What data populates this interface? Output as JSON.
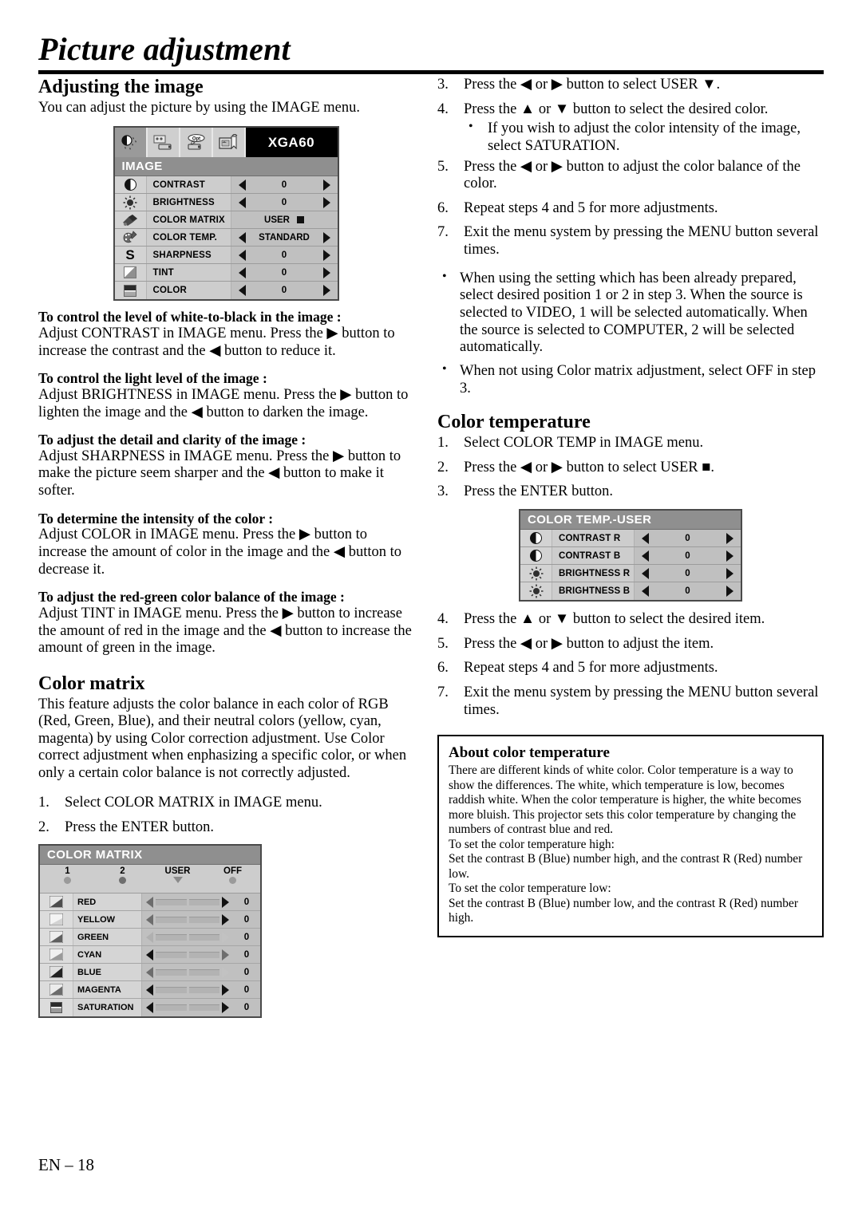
{
  "page": {
    "title": "Picture adjustment",
    "footer": "EN – 18"
  },
  "left": {
    "section1_title": "Adjusting the image",
    "section1_intro": "You can adjust the picture by using the IMAGE menu.",
    "image_menu": {
      "signal_label": "XGA60",
      "menu_title": "IMAGE",
      "tabs": [
        "image-tab-icon",
        "install-tab-icon",
        "option-tab-icon",
        "feature-tab-icon"
      ],
      "rows": [
        {
          "icon": "contrast-icon",
          "label": "CONTRAST",
          "value": "0",
          "control": "arrows"
        },
        {
          "icon": "brightness-icon",
          "label": "BRIGHTNESS",
          "value": "0",
          "control": "arrows"
        },
        {
          "icon": "color-matrix-icon",
          "label": "COLOR MATRIX",
          "value": "USER",
          "control": "square"
        },
        {
          "icon": "color-temp-icon",
          "label": "COLOR TEMP.",
          "value": "STANDARD",
          "control": "arrows"
        },
        {
          "icon": "sharpness-icon",
          "label": "SHARPNESS",
          "value": "0",
          "control": "arrows"
        },
        {
          "icon": "tint-icon",
          "label": "TINT",
          "value": "0",
          "control": "arrows"
        },
        {
          "icon": "color-icon",
          "label": "COLOR",
          "value": "0",
          "control": "arrows"
        }
      ]
    },
    "tips": [
      {
        "head": "To control the level of white-to-black in the image :",
        "body": "Adjust CONTRAST in IMAGE menu.  Press the ▶ button to increase the contrast and the ◀ button to reduce it."
      },
      {
        "head": "To control the light level of the image :",
        "body": "Adjust BRIGHTNESS in IMAGE menu.  Press the ▶ button to lighten the image and the ◀ button to darken the image."
      },
      {
        "head": "To adjust the detail and clarity of the image :",
        "body": "Adjust SHARPNESS in IMAGE menu.  Press the ▶ button to make the picture seem sharper and the ◀ button to make it softer."
      },
      {
        "head": "To determine the intensity of the color :",
        "body": "Adjust COLOR in IMAGE menu.  Press the ▶ button to increase the amount of color in the image and the ◀ button to decrease it."
      },
      {
        "head": "To adjust the red-green color balance of the image :",
        "body": "Adjust TINT in IMAGE menu.  Press the ▶ button to increase the amount of red in the image and the ◀ button to increase the amount of green in the image."
      }
    ],
    "section2_title": "Color matrix",
    "section2_body": "This feature adjusts the color balance in each color of RGB (Red, Green, Blue), and their neutral colors (yellow, cyan, magenta) by using Color correction adjustment. Use Color correct adjustment when enphasizing a specific color, or when only a certain color balance is not correctly adjusted.",
    "section2_steps": [
      {
        "num": "1.",
        "text": "Select COLOR MATRIX in IMAGE menu."
      },
      {
        "num": "2.",
        "text": "Press the ENTER button."
      }
    ],
    "color_matrix_menu": {
      "menu_title": "COLOR MATRIX",
      "options": [
        {
          "label": "1",
          "mark": "dot",
          "selected": false
        },
        {
          "label": "2",
          "mark": "dot",
          "selected": true
        },
        {
          "label": "USER",
          "mark": "triangle",
          "selected": false
        },
        {
          "label": "OFF",
          "mark": "dot",
          "selected": false
        }
      ],
      "rows": [
        {
          "icon": "red-swatch-icon",
          "label": "RED",
          "value": "0"
        },
        {
          "icon": "yellow-swatch-icon",
          "label": "YELLOW",
          "value": "0"
        },
        {
          "icon": "green-swatch-icon",
          "label": "GREEN",
          "value": "0"
        },
        {
          "icon": "cyan-swatch-icon",
          "label": "CYAN",
          "value": "0"
        },
        {
          "icon": "blue-swatch-icon",
          "label": "BLUE",
          "value": "0"
        },
        {
          "icon": "magenta-swatch-icon",
          "label": "MAGENTA",
          "value": "0"
        },
        {
          "icon": "saturation-icon",
          "label": "SATURATION",
          "value": "0"
        }
      ]
    }
  },
  "right": {
    "steps_matrix": [
      {
        "num": "3.",
        "text": "Press the ◀ or ▶ button to select USER ▼."
      },
      {
        "num": "4.",
        "text": "Press the ▲ or ▼ button to select the desired color."
      },
      {
        "num": "5.",
        "text": "Press the ◀ or ▶ button to adjust the color balance of the color."
      },
      {
        "num": "6.",
        "text": "Repeat steps 4 and 5 for more adjustments."
      },
      {
        "num": "7.",
        "text": "Exit the menu system by pressing the MENU button several times."
      }
    ],
    "step4_sub_bullet": "If you wish to adjust the color intensity of the image, select SATURATION.",
    "notes": [
      "When using the setting which has been already prepared, select desired position 1 or 2 in step 3. When the source is selected to VIDEO, 1 will be selected automatically. When the source is selected to COMPUTER, 2 will be selected automatically.",
      "When not using Color matrix adjustment, select OFF in step 3."
    ],
    "section3_title": "Color temperature",
    "steps_temp_pre": [
      {
        "num": "1.",
        "text": "Select COLOR TEMP in IMAGE menu."
      },
      {
        "num": "2.",
        "text": "Press the ◀ or ▶ button to select USER ■."
      },
      {
        "num": "3.",
        "text": "Press the ENTER button."
      }
    ],
    "color_temp_menu": {
      "menu_title": "COLOR TEMP.-USER",
      "rows": [
        {
          "icon": "contrast-icon",
          "label": "CONTRAST R",
          "value": "0"
        },
        {
          "icon": "contrast-icon",
          "label": "CONTRAST B",
          "value": "0"
        },
        {
          "icon": "brightness-icon",
          "label": "BRIGHTNESS R",
          "value": "0"
        },
        {
          "icon": "brightness-icon",
          "label": "BRIGHTNESS B",
          "value": "0"
        }
      ]
    },
    "steps_temp_post": [
      {
        "num": "4.",
        "text": "Press the ▲ or ▼ button to select the desired item."
      },
      {
        "num": "5.",
        "text": "Press the ◀ or ▶ button to adjust the item."
      },
      {
        "num": "6.",
        "text": "Repeat steps 4 and 5 for more adjustments."
      },
      {
        "num": "7.",
        "text": "Exit the menu system by pressing the MENU button several times."
      }
    ],
    "about_box": {
      "title": "About color temperature",
      "paragraphs": [
        "There are different kinds of white color. Color temperature is a way to show the differences. The white, which temperature is low, becomes raddish white. When the color temperature is higher, the white becomes more bluish. This projector sets this color temperature by changing the numbers of contrast blue and red.",
        "To set the color temperature high:",
        "Set the contrast B (Blue) number high, and the contrast R (Red) number low.",
        "To set the color temperature low:",
        "Set the contrast B (Blue) number low, and the contrast R (Red) number high."
      ]
    }
  },
  "colors": {
    "osd_background": "#c7c7c7",
    "osd_header_bar": "#8f8f8f",
    "osd_signal_bar": "#000000",
    "text": "#000000"
  }
}
